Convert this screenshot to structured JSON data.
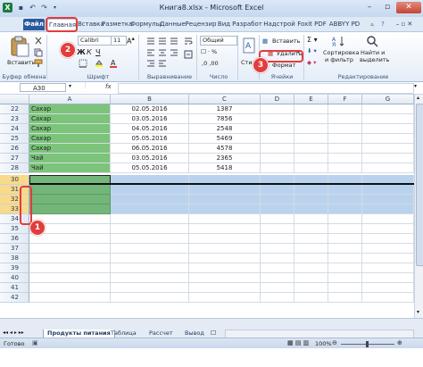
{
  "window": {
    "title": "Книга8.xlsx - Microsoft Excel"
  },
  "tabs": [
    {
      "label": "Файл"
    },
    {
      "label": "Главная"
    },
    {
      "label": "Вставка"
    },
    {
      "label": "Разметка"
    },
    {
      "label": "Формулы"
    },
    {
      "label": "Данные"
    },
    {
      "label": "Рецензир"
    },
    {
      "label": "Вид"
    },
    {
      "label": "Разработ"
    },
    {
      "label": "Надстрой"
    },
    {
      "label": "Foxit PDF"
    },
    {
      "label": "ABBYY PD"
    }
  ],
  "ribbon": {
    "paste_label": "Вставить",
    "font_name": "Calibri",
    "font_size": "11",
    "number_format": "Общий",
    "styles_label": "Стили",
    "insert_label": "Вставить",
    "delete_label": "Удалить",
    "format_label": "Формат",
    "sort_label": "Сортировка",
    "sort_label2": "и фильтр",
    "find_label": "Найти и",
    "find_label2": "выделить",
    "groups": {
      "clipboard": "Буфер обмена",
      "font": "Шрифт",
      "alignment": "Выравнивание",
      "number": "Число",
      "cells": "Ячейки",
      "editing": "Редактирование"
    }
  },
  "formula_bar": {
    "name_box": "A30",
    "fx": "fx"
  },
  "grid": {
    "columns": [
      "A",
      "B",
      "C",
      "D",
      "E",
      "F",
      "G"
    ],
    "rows": [
      {
        "num": "22",
        "a": "Сахар",
        "b": "02.05.2016",
        "c": "1387"
      },
      {
        "num": "23",
        "a": "Сахар",
        "b": "03.05.2016",
        "c": "7856"
      },
      {
        "num": "24",
        "a": "Сахар",
        "b": "04.05.2016",
        "c": "2548"
      },
      {
        "num": "25",
        "a": "Сахар",
        "b": "05.05.2016",
        "c": "5469"
      },
      {
        "num": "26",
        "a": "Сахар",
        "b": "06.05.2016",
        "c": "4578"
      },
      {
        "num": "27",
        "a": "Чай",
        "b": "03.05.2016",
        "c": "2365"
      },
      {
        "num": "28",
        "a": "Чай",
        "b": "05.05.2016",
        "c": "5418"
      },
      {
        "num": "30",
        "a": "",
        "b": "",
        "c": ""
      },
      {
        "num": "31",
        "a": "",
        "b": "",
        "c": ""
      },
      {
        "num": "32",
        "a": "",
        "b": "",
        "c": ""
      },
      {
        "num": "33",
        "a": "",
        "b": "",
        "c": ""
      },
      {
        "num": "34",
        "a": "",
        "b": "",
        "c": ""
      },
      {
        "num": "35",
        "a": "",
        "b": "",
        "c": ""
      },
      {
        "num": "36",
        "a": "",
        "b": "",
        "c": ""
      },
      {
        "num": "37",
        "a": "",
        "b": "",
        "c": ""
      },
      {
        "num": "38",
        "a": "",
        "b": "",
        "c": ""
      },
      {
        "num": "39",
        "a": "",
        "b": "",
        "c": ""
      },
      {
        "num": "40",
        "a": "",
        "b": "",
        "c": ""
      },
      {
        "num": "41",
        "a": "",
        "b": "",
        "c": ""
      },
      {
        "num": "42",
        "a": "",
        "b": "",
        "c": ""
      }
    ]
  },
  "sheets": [
    "Продукты питания",
    "Таблица",
    "Рассчет",
    "Вывод"
  ],
  "status": {
    "text": "Готово",
    "zoom": "100%"
  },
  "annotations": [
    "1",
    "2",
    "3"
  ],
  "colors": {
    "green": "#7bc47a",
    "blue_fill": "#b9d3ee",
    "header_fill": "#ffff00",
    "accent": "#e33c3c"
  }
}
